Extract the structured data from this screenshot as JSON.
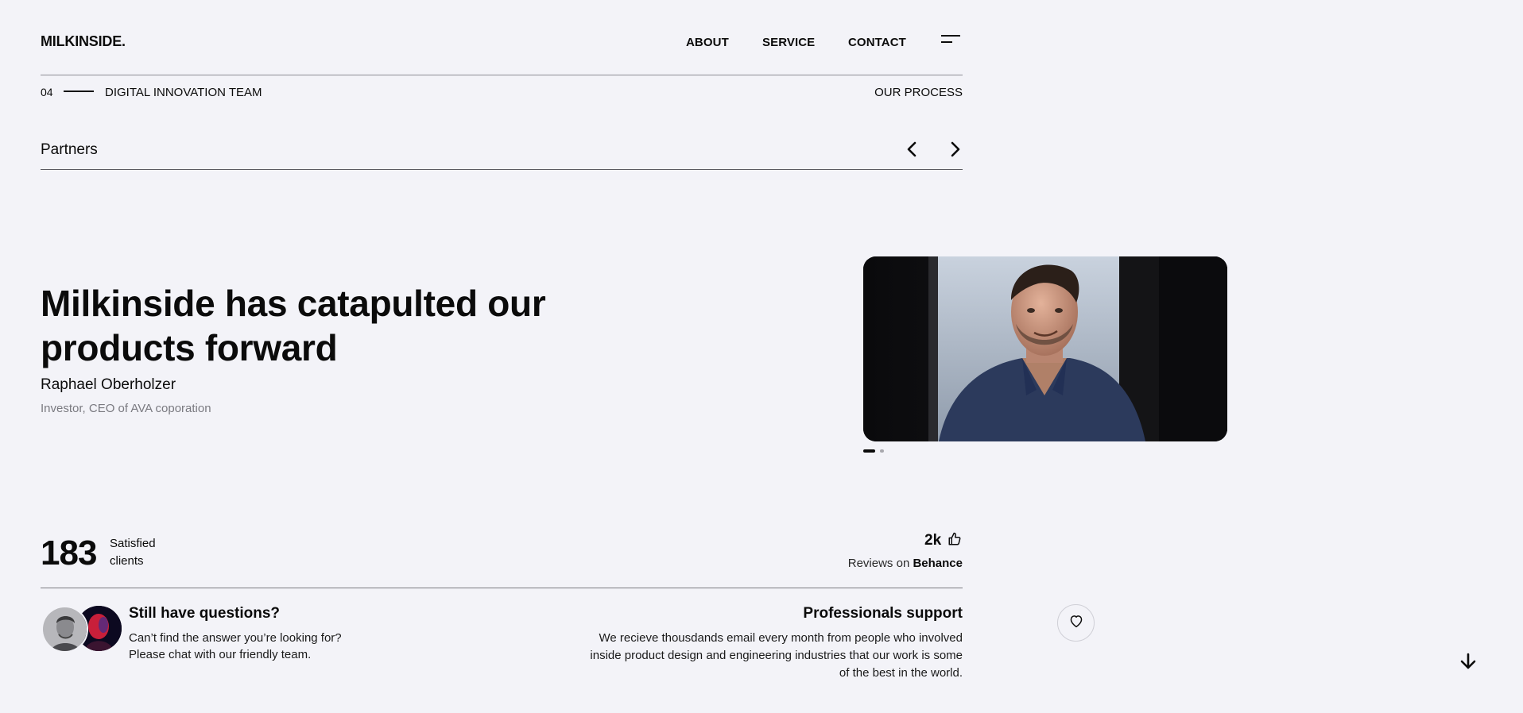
{
  "header": {
    "logo": "MILKINSIDE.",
    "nav": [
      "ABOUT",
      "SERVICE",
      "CONTACT"
    ],
    "menu_icon": "hamburger-menu-icon"
  },
  "crumb": {
    "number": "04",
    "label": "DIGITAL INNOVATION TEAM",
    "right_link": "OUR PROCESS"
  },
  "partners": {
    "title": "Partners",
    "prev_icon": "chevron-left-icon",
    "next_icon": "chevron-right-icon"
  },
  "testimonial": {
    "quote": "Milkinside has catapulted our products forward",
    "author": "Raphael Oberholzer",
    "role": "Investor, CEO of AVA coporation",
    "slide_count": 2,
    "active_slide": 1
  },
  "stats": {
    "clients_number": "183",
    "clients_label": "Satisfied clients",
    "reviews_number": "2k",
    "reviews_icon": "thumbs-up-icon",
    "reviews_prefix": "Reviews on",
    "reviews_platform": "Behance"
  },
  "questions": {
    "title": "Still have questions?",
    "body": "Can’t find the answer you’re looking for? Please chat with our friendly team."
  },
  "support": {
    "title": "Professionals support",
    "body": "We recieve thousdands email every month from people who involved inside product design and engineering industries that our work is some of the best in the world."
  },
  "floating": {
    "heart_icon": "heart-icon",
    "scroll_icon": "arrow-down-icon"
  }
}
